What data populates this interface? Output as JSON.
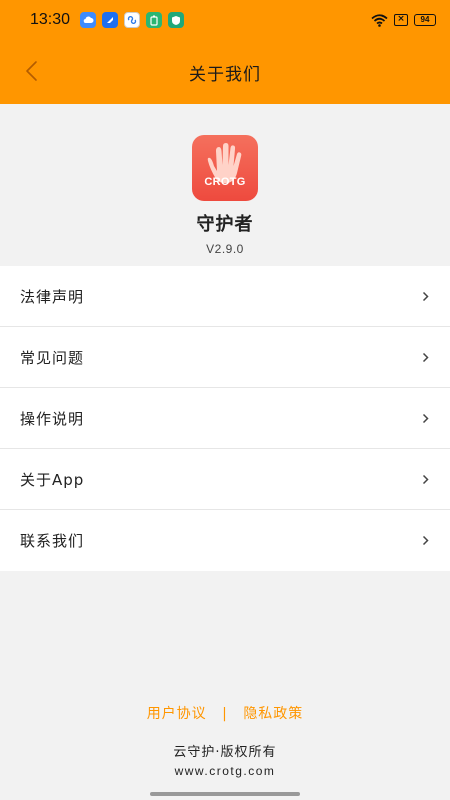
{
  "status_bar": {
    "time": "13:30",
    "battery": "94",
    "notification_icons": [
      "cloud-icon",
      "feather-icon",
      "infinity-icon",
      "battery-saver-icon",
      "shield-icon"
    ]
  },
  "nav": {
    "title": "关于我们",
    "back_icon": "chevron-left-icon"
  },
  "app": {
    "logo_text": "CROTG",
    "name": "守护者",
    "version": "V2.9.0"
  },
  "menu": {
    "items": [
      {
        "label": "法律声明"
      },
      {
        "label": "常见问题"
      },
      {
        "label": "操作说明"
      },
      {
        "label": "关于App"
      },
      {
        "label": "联系我们"
      }
    ]
  },
  "footer": {
    "user_agreement": "用户协议",
    "separator": "|",
    "privacy_policy": "隐私政策",
    "copyright": "云守护·版权所有",
    "website": "www.crotg.com"
  },
  "colors": {
    "accent": "#ff9600",
    "logo": "#ef5444",
    "background": "#f2f2f2"
  }
}
